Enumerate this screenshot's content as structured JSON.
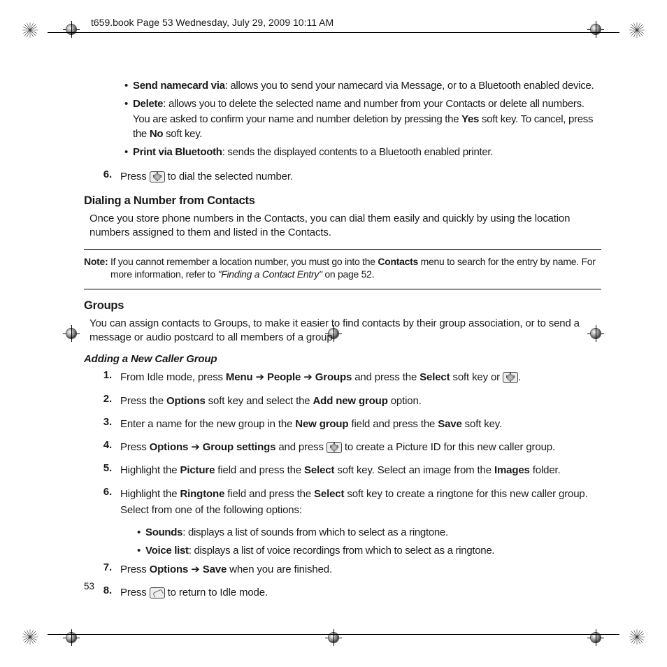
{
  "header_text": "t659.book  Page 53  Wednesday, July 29, 2009  10:11 AM",
  "page_number": "53",
  "bullets_top": [
    {
      "label": "Send namecard via",
      "text": ": allows you to send your namecard via Message, or to a Bluetooth enabled device."
    },
    {
      "label": "Delete",
      "text": ": allows you to delete the selected name and number from your Contacts or delete all numbers. You are asked to confirm your name and number deletion by pressing the ",
      "extra1_bold": "Yes",
      "extra1_rest": " soft key. To cancel, press the ",
      "extra2_bold": "No",
      "extra2_rest": " soft key."
    },
    {
      "label": "Print via Bluetooth",
      "text": ": sends the displayed contents to a Bluetooth enabled printer."
    }
  ],
  "step6": {
    "num": "6.",
    "pre": "Press ",
    "post": " to dial the selected number."
  },
  "h_dial_heading": "Dialing a Number from Contacts",
  "dial_para": "Once you store phone numbers in the Contacts, you can dial them easily and quickly by using the location numbers assigned to them and listed in the Contacts.",
  "note": {
    "label": "Note:",
    "pre": " If you cannot remember a location number, you must go into the ",
    "bold1": "Contacts",
    "mid": " menu to search for the entry by name. For more information, refer to ",
    "ref": "\"Finding a Contact Entry\"",
    "post": "  on page 52."
  },
  "h_groups": "Groups",
  "groups_para": "You can assign contacts to Groups, to make it easier to find contacts by their group association, or to send a message or audio postcard to all members of a group.",
  "h_add": "Adding a New Caller Group",
  "steps": {
    "1": {
      "num": "1.",
      "p1": "From Idle mode, press ",
      "b1": "Menu",
      "arr1": "  ➔ ",
      "b2": "People",
      "arr2": " ➔ ",
      "b3": "Groups",
      "p2": " and press the ",
      "b4": "Select",
      "p3": " soft key or ",
      "p4": "."
    },
    "2": {
      "num": "2.",
      "p1": "Press the ",
      "b1": "Options",
      "p2": " soft key and select the ",
      "b2": "Add new group",
      "p3": " option."
    },
    "3": {
      "num": "3.",
      "p1": "Enter a name for the new group in the ",
      "b1": "New group",
      "p2": " field and press the ",
      "b2": "Save",
      "p3": " soft key."
    },
    "4": {
      "num": "4.",
      "p1": "Press ",
      "b1": "Options",
      "arr1": "  ➔ ",
      "b2": "Group settings",
      "p2": " and press ",
      "p3": " to create a Picture ID for this new caller group."
    },
    "5": {
      "num": "5.",
      "p1": "Highlight the ",
      "b1": "Picture",
      "p2": " field and press the ",
      "b2": "Select",
      "p3": " soft key. Select an image from the ",
      "b3": "Images",
      "p4": " folder."
    },
    "6": {
      "num": "6.",
      "p1": "Highlight the ",
      "b1": "Ringtone",
      "p2": " field and press the ",
      "b2": "Select",
      "p3": " soft key to create a ringtone for this new caller group. Select from one of the following options:"
    },
    "7": {
      "num": "7.",
      "p1": "Press ",
      "b1": "Options",
      "arr1": "  ➔ ",
      "b2": "Save",
      "p2": " when you are finished."
    },
    "8": {
      "num": "8.",
      "p1": "Press ",
      "p2": " to return to Idle mode."
    }
  },
  "sub_bullets_6": [
    {
      "label": "Sounds",
      "text": ": displays a list of sounds from which to select as a ringtone."
    },
    {
      "label": "Voice list",
      "text": ": displays a list of voice recordings from which to select as a ringtone."
    }
  ]
}
